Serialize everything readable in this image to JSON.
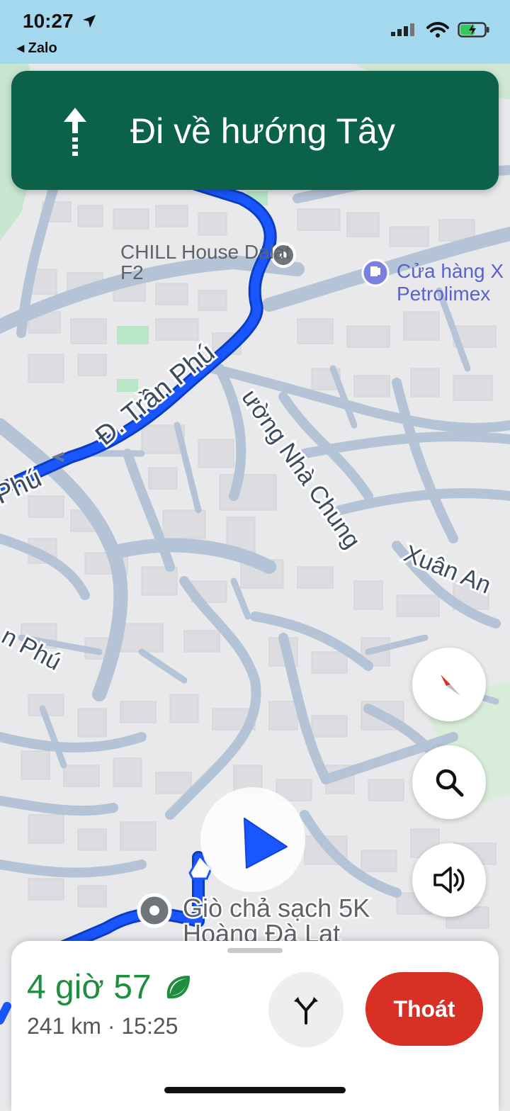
{
  "status_bar": {
    "time": "10:27",
    "back_app": "◂ Zalo"
  },
  "navigation": {
    "instruction": "Đi về hướng Tây"
  },
  "map": {
    "poi_chill_line1": "CHILL House Dalat",
    "poi_chill_line2": "F2",
    "poi_petrol_line1": "Cửa hàng X",
    "poi_petrol_line2": "Petrolimex",
    "street_tran_phu": "Đ. Trần Phú",
    "street_phu_left": "Phú",
    "street_phu_lower": "n Phú",
    "street_nha_chung": "ường Nhà Chung",
    "street_xuan_an": "Xuân An",
    "poi_gio_cha_line1": "Giò chả sạch 5K",
    "poi_gio_cha_line2": "Hoàng Đà Lạt"
  },
  "trip": {
    "duration": "4 giờ 57",
    "details": "241 km · 15:25",
    "exit_label": "Thoát"
  },
  "colors": {
    "route": "#1a56ff",
    "banner": "#0b6248",
    "eta": "#1e8e3e",
    "exit": "#d93025"
  },
  "icons": [
    "compass-icon",
    "search-icon",
    "volume-icon",
    "alt-routes-icon",
    "leaf-icon",
    "navigation-arrow-icon",
    "location-arrow-icon",
    "signal-icon",
    "wifi-icon",
    "battery-icon"
  ]
}
